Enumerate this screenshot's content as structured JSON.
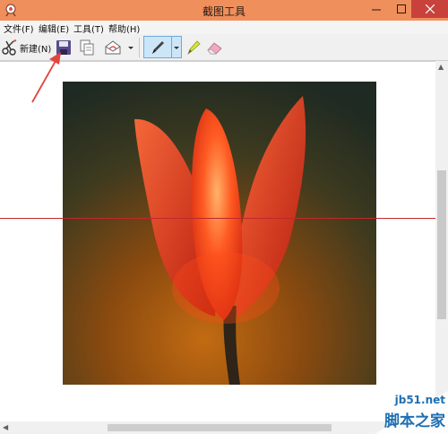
{
  "window": {
    "title": "截图工具"
  },
  "menu": [
    "文件(F)",
    "编辑(E)",
    "工具(T)",
    "帮助(H)"
  ],
  "toolbar": {
    "new_label": "新建(N)"
  },
  "watermark": {
    "line1": "jb51.net",
    "line2": "脚本之家"
  },
  "colors": {
    "titlebar": "#ef8f5c",
    "close": "#c8413b",
    "annotation": "#e0463c",
    "redline": "#c0282a"
  }
}
